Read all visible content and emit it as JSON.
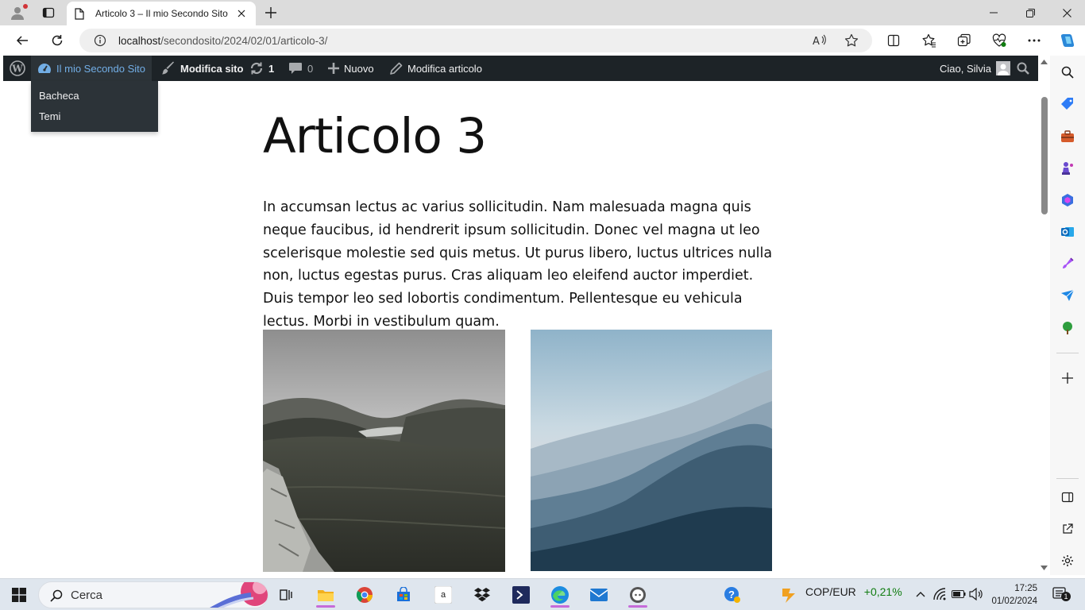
{
  "browser": {
    "tab_title": "Articolo 3 – Il mio Secondo Sito",
    "url_host": "localhost",
    "url_path": "/secondosito/2024/02/01/articolo-3/"
  },
  "adminbar": {
    "site_name": "Il mio Secondo Sito",
    "edit_site": "Modifica sito",
    "updates_count": "1",
    "comments_count": "0",
    "new_label": "Nuovo",
    "edit_post": "Modifica articolo",
    "greeting": "Ciao, Silvia",
    "site_menu": [
      {
        "label": "Bacheca"
      },
      {
        "label": "Temi"
      }
    ]
  },
  "post": {
    "title": "Articolo 3",
    "body": "In accumsan lectus ac varius sollicitudin. Nam malesuada magna quis neque faucibus, id hendrerit ipsum sollicitudin. Donec vel magna ut leo scelerisque molestie sed quis metus. Ut purus libero, luctus ultrices nulla non, luctus egestas purus. Cras aliquam leo eleifend auctor imperdiet. Duis tempor leo sed lobortis condimentum. Pellentesque eu vehicula lectus. Morbi in vestibulum quam."
  },
  "taskbar": {
    "search_placeholder": "Cerca",
    "ticker_name": "COP/EUR",
    "ticker_change": "+0,21%",
    "time": "17:25",
    "date": "01/02/2024",
    "notification_count": "1"
  },
  "colors": {
    "adminbar_bg": "#1d2327",
    "adminbar_active": "#72aee6",
    "ticker_positive": "#107c10"
  }
}
